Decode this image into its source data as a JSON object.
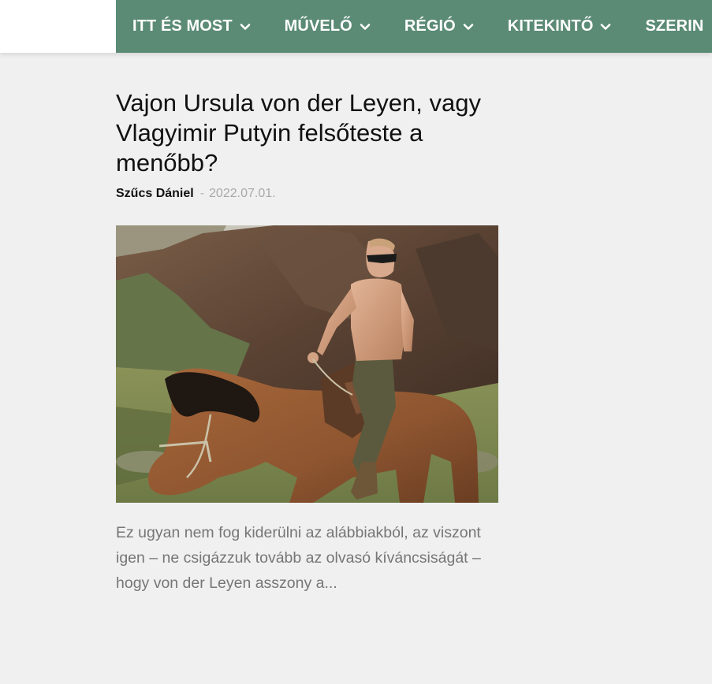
{
  "nav": {
    "items": [
      {
        "label": "ITT ÉS MOST"
      },
      {
        "label": "MŰVELŐ"
      },
      {
        "label": "RÉGIÓ"
      },
      {
        "label": "KITEKINTŐ"
      },
      {
        "label": "SZERIN"
      }
    ]
  },
  "article": {
    "title": "Vajon Ursula von der Leyen, vagy Vlagyimir Putyin felsőteste a menőbb?",
    "author": "Szűcs Dániel",
    "separator": "-",
    "date": "2022.07.01.",
    "excerpt": "Ez ugyan nem fog kiderülni az alábbiakból, az viszont igen – ne csigázzuk tovább az olvasó kíváncsiságát – hogy von der Leyen asszony a..."
  },
  "colors": {
    "nav_bg": "#5b8b75",
    "page_bg": "#f0f0f0",
    "title": "#111111",
    "excerpt": "#767676",
    "date": "#a9a9a9"
  }
}
